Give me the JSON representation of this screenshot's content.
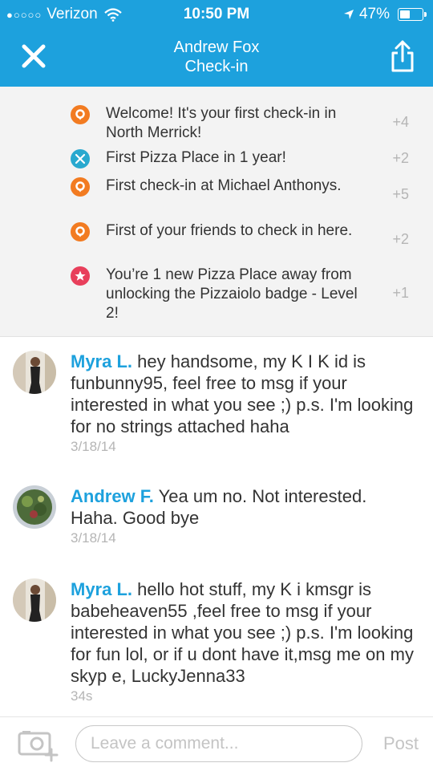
{
  "status_bar": {
    "signal_dots": "●○○○○",
    "carrier": "Verizon",
    "time": "10:50 PM",
    "battery": "47%",
    "battery_level": 0.47
  },
  "nav": {
    "title_line1": "Andrew Fox",
    "title_line2": "Check-in"
  },
  "score_items": [
    {
      "icon": "location-pin-icon",
      "color": "#f27b21",
      "text": "Welcome! It's your first check-in in North Merrick!",
      "points": "+4"
    },
    {
      "icon": "fork-knife-icon",
      "color": "#29a9cf",
      "text": "First Pizza Place in 1 year!",
      "points": "+2"
    },
    {
      "icon": "location-pin-icon",
      "color": "#f27b21",
      "text": "First check-in at Michael Anthonys.",
      "points": "+5"
    },
    {
      "icon": "location-pin-icon",
      "color": "#f27b21",
      "text": "First of your friends to check in here.",
      "points": "+2"
    },
    {
      "icon": "star-icon",
      "color": "#e83f5b",
      "text": "You’re 1 new Pizza Place away from unlocking the Pizzaiolo badge - Level 2!",
      "points": "+1"
    }
  ],
  "comments": [
    {
      "name": "Myra L.",
      "text": "hey handsome, my K I K id is funbunny95, feel free to msg if your interested in what you see ;) p.s. I'm looking for no strings attached haha",
      "date": "3/18/14"
    },
    {
      "name": "Andrew F.",
      "text": "Yea um no. Not interested. Haha. Good bye",
      "date": "3/18/14"
    },
    {
      "name": "Myra L.",
      "text": "hello hot stuff, my K i kmsgr is babeheaven55 ,feel free to msg if your interested in what you see ;) p.s. I'm looking for fun lol, or if u dont have it,msg me on my skyp e, LuckyJenna33",
      "date": "34s"
    }
  ],
  "compose": {
    "placeholder": "Leave a comment...",
    "post_label": "Post"
  },
  "colors": {
    "brand_blue": "#1da1dd",
    "pin_orange": "#f27b21",
    "food_teal": "#29a9cf",
    "badge_red": "#e83f5b"
  }
}
